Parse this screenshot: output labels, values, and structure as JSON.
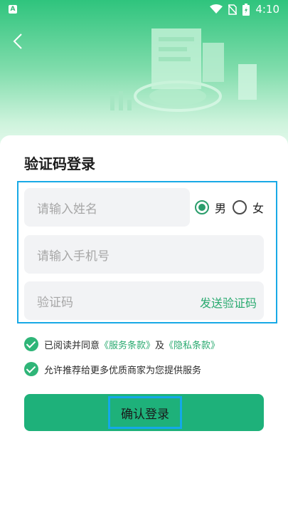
{
  "status_bar": {
    "time": "4:10",
    "app_icon_letter": "A"
  },
  "header": {
    "back_icon": "chevron-left-icon"
  },
  "form": {
    "title": "验证码登录",
    "name_placeholder": "请输入姓名",
    "phone_placeholder": "请输入手机号",
    "code_placeholder": "验证码",
    "send_code_label": "发送验证码",
    "gender": {
      "options": [
        "男",
        "女"
      ],
      "selected": "男"
    }
  },
  "agreements": {
    "line1_prefix": "已阅读并同意",
    "terms_link": "《服务条款》",
    "connector": "及",
    "privacy_link": "《隐私条款》",
    "line2": "允许推荐给更多优质商家为您提供服务"
  },
  "submit_label": "确认登录",
  "colors": {
    "accent": "#1eb17a",
    "highlight_border": "#18a9e6"
  }
}
